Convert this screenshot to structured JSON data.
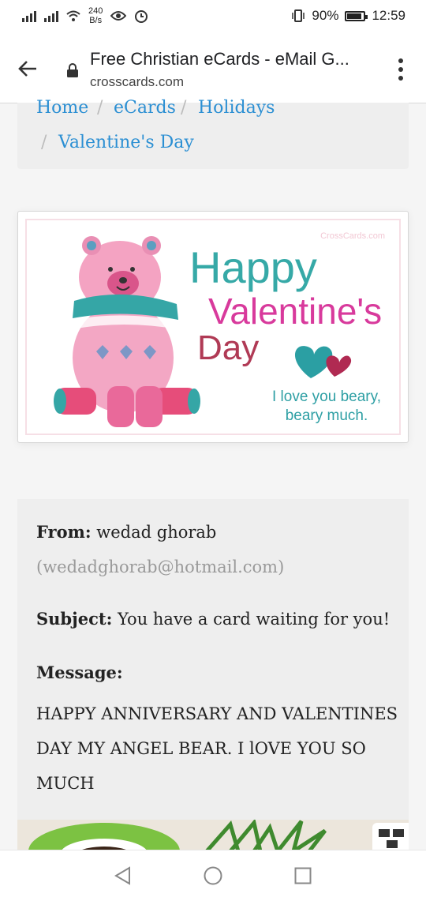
{
  "status": {
    "net_speed_value": "240",
    "net_speed_unit": "B/s",
    "battery": "90%",
    "battery_level": 0.9,
    "time": "12:59"
  },
  "browser": {
    "title": "Free Christian eCards - eMail G...",
    "domain": "crosscards.com"
  },
  "breadcrumb": {
    "items": [
      "Home",
      "eCards",
      "Holidays",
      "Valentine's Day"
    ],
    "separator": "/"
  },
  "ecard": {
    "watermark": "CrossCards.com",
    "line1": "Happy",
    "line2": "Valentine's",
    "line3": "Day",
    "tagline1": "I love you beary,",
    "tagline2": "beary much."
  },
  "message": {
    "from_label": "From:",
    "from_name": "wedad ghorab",
    "from_email": "(wedadghorab@hotmail.com)",
    "subject_label": "Subject:",
    "subject": "You have a card waiting for you!",
    "message_label": "Message:",
    "body": "HAPPY ANNIVERSARY AND VALENTINES DAY MY ANGEL BEAR. I lOVE YOU SO MUCH"
  },
  "colors": {
    "link": "#2b8fd3",
    "card_bg": "#eeeeee",
    "teal": "#36a9a7",
    "magenta": "#d83a9c",
    "crimson": "#b03a55"
  }
}
